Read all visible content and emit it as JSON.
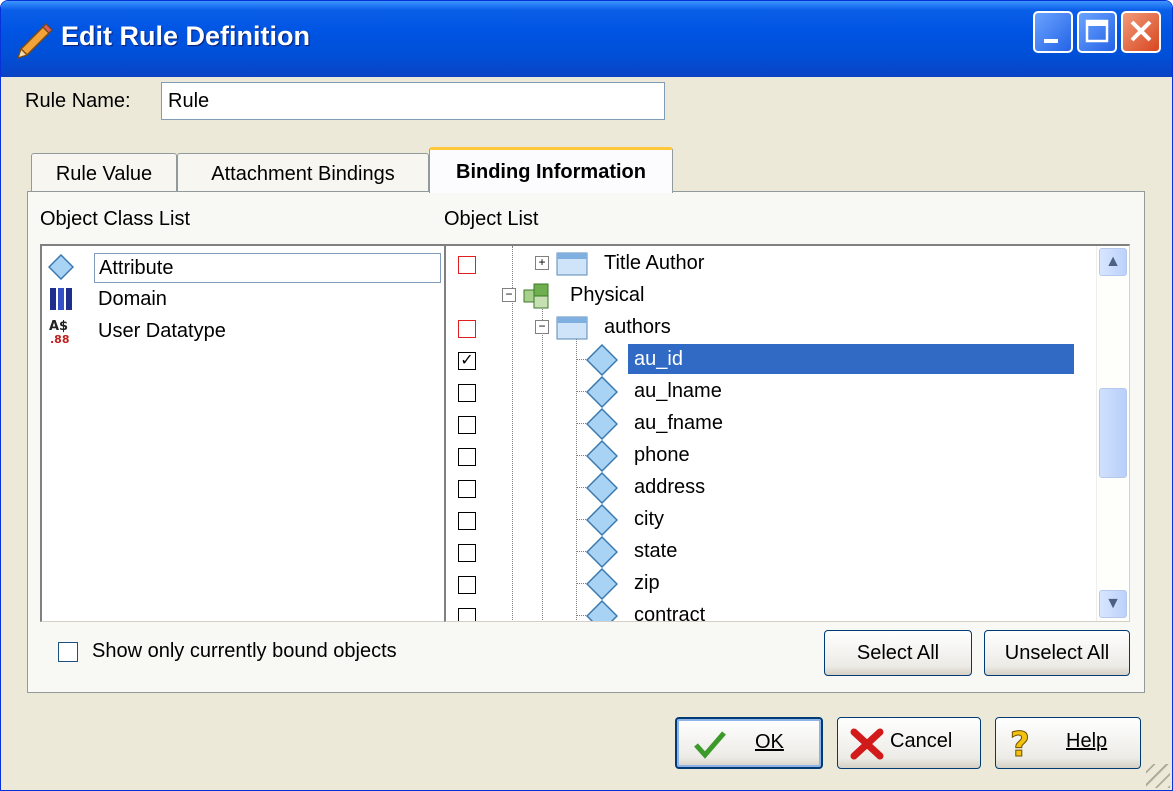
{
  "window": {
    "title": "Edit Rule Definition"
  },
  "rule_name": {
    "label": "Rule Name:",
    "value": "Rule"
  },
  "tabs": [
    {
      "label": "Rule Value",
      "active": false
    },
    {
      "label": "Attachment Bindings",
      "active": false
    },
    {
      "label": "Binding Information",
      "active": true
    }
  ],
  "object_class_list": {
    "label": "Object Class List",
    "items": [
      {
        "label": "Attribute",
        "icon": "attribute-diamond-icon",
        "selected": true
      },
      {
        "label": "Domain",
        "icon": "domain-icon",
        "selected": false
      },
      {
        "label": "User Datatype",
        "icon": "user-datatype-icon",
        "selected": false
      }
    ]
  },
  "object_list": {
    "label": "Object List",
    "items": [
      {
        "label": "Title Author",
        "type": "table",
        "checked": false,
        "checkbox": "red"
      },
      {
        "label": "Physical",
        "type": "model",
        "checkbox": "none"
      },
      {
        "label": "authors",
        "type": "table",
        "checked": false,
        "checkbox": "red"
      },
      {
        "label": "au_id",
        "type": "column",
        "checked": true,
        "selected": true
      },
      {
        "label": "au_lname",
        "type": "column",
        "checked": false
      },
      {
        "label": "au_fname",
        "type": "column",
        "checked": false
      },
      {
        "label": "phone",
        "type": "column",
        "checked": false
      },
      {
        "label": "address",
        "type": "column",
        "checked": false
      },
      {
        "label": "city",
        "type": "column",
        "checked": false
      },
      {
        "label": "state",
        "type": "column",
        "checked": false
      },
      {
        "label": "zip",
        "type": "column",
        "checked": false
      },
      {
        "label": "contract",
        "type": "column",
        "checked": false
      }
    ]
  },
  "show_bound_only": {
    "label": "Show only currently bound objects",
    "checked": false
  },
  "buttons": {
    "select_all": "Select All",
    "unselect_all": "Unselect All",
    "ok": "OK",
    "cancel": "Cancel",
    "help": "Help"
  },
  "colors": {
    "titlebar": "#0054e3",
    "selection": "#316ac5",
    "face": "#ece9d8"
  }
}
